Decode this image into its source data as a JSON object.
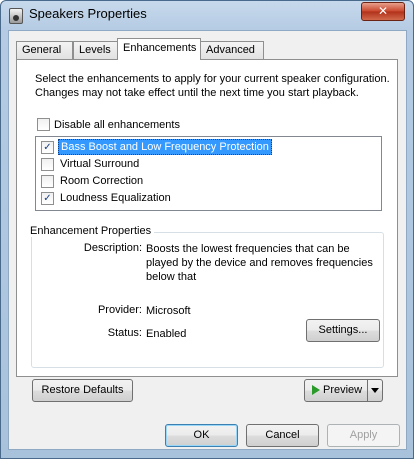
{
  "window": {
    "title": "Speakers Properties",
    "close_glyph": "✕"
  },
  "tabs": [
    {
      "label": "General"
    },
    {
      "label": "Levels"
    },
    {
      "label": "Enhancements"
    },
    {
      "label": "Advanced"
    }
  ],
  "enhancements": {
    "description": "Select the enhancements to apply for your current speaker configuration. Changes may not take effect until the next time you start playback.",
    "disable_all": {
      "label": "Disable all enhancements",
      "checked": false
    },
    "items": [
      {
        "label": "Bass Boost and Low Frequency Protection",
        "checked": true,
        "selected": true
      },
      {
        "label": "Virtual Surround",
        "checked": false,
        "selected": false
      },
      {
        "label": "Room Correction",
        "checked": false,
        "selected": false
      },
      {
        "label": "Loudness Equalization",
        "checked": true,
        "selected": false
      }
    ]
  },
  "properties": {
    "title": "Enhancement Properties",
    "description_label": "Description:",
    "description_value": "Boosts the lowest frequencies that can be played by the device and removes frequencies below that",
    "provider_label": "Provider:",
    "provider_value": "Microsoft",
    "status_label": "Status:",
    "status_value": "Enabled",
    "settings_button": "Settings..."
  },
  "buttons": {
    "restore_defaults": "Restore Defaults",
    "preview": "Preview",
    "ok": "OK",
    "cancel": "Cancel",
    "apply": "Apply"
  },
  "icons": {
    "checkmark": "✓"
  }
}
